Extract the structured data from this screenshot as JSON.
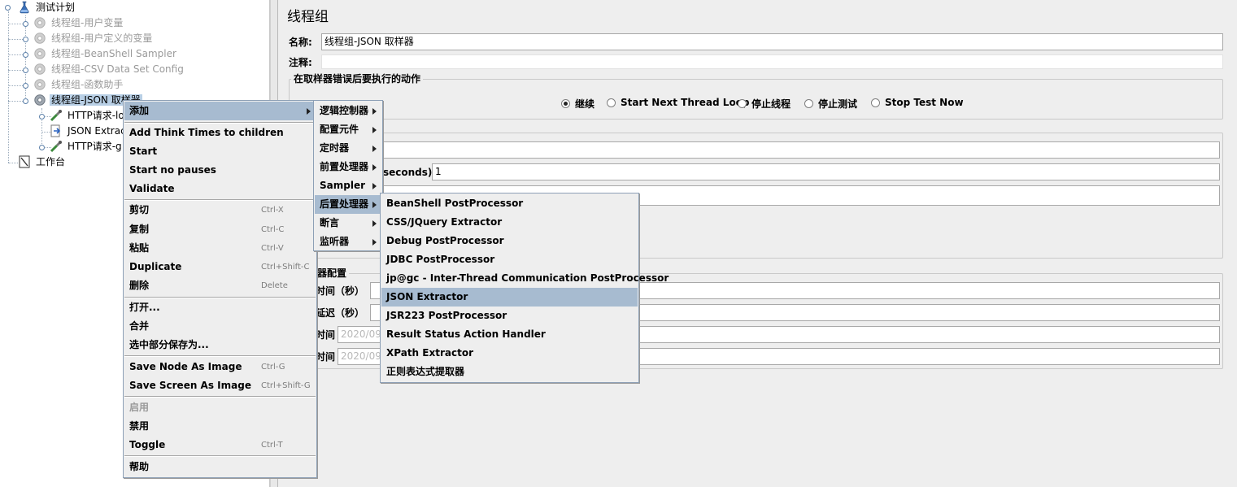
{
  "tree": {
    "root": "测试计划",
    "children": [
      {
        "label": "线程组-用户变量",
        "icon": "gear-icon",
        "disabled": true
      },
      {
        "label": "线程组-用户定义的变量",
        "icon": "gear-icon",
        "disabled": true
      },
      {
        "label": "线程组-BeanShell Sampler",
        "icon": "gear-icon",
        "disabled": true
      },
      {
        "label": "线程组-CSV Data Set Config",
        "icon": "gear-icon",
        "disabled": true
      },
      {
        "label": "线程组-函数助手",
        "icon": "gear-icon",
        "disabled": true
      },
      {
        "label": "线程组-JSON 取样器",
        "icon": "gear-icon",
        "selected": true
      }
    ],
    "sub_children": [
      {
        "label": "HTTP请求-lo",
        "icon": "pipette-icon"
      },
      {
        "label": "JSON Extrac",
        "icon": "document-arrow-icon"
      },
      {
        "label": "HTTP请求-g",
        "icon": "pipette-icon"
      }
    ],
    "workbench": "工作台"
  },
  "panel": {
    "title": "线程组",
    "name_label": "名称:",
    "name_value": "线程组-JSON 取样器",
    "comment_label": "注释:",
    "comment_value": "",
    "action_group_title": "在取样器错误后要执行的动作",
    "actions": [
      {
        "label": "继续",
        "selected": true
      },
      {
        "label": "Start Next Thread Loop",
        "selected": false
      },
      {
        "label": "停止线程",
        "selected": false
      },
      {
        "label": "停止测试",
        "selected": false
      },
      {
        "label": "Stop Test Now",
        "selected": false
      }
    ],
    "rampup_label_partial": "seconds):",
    "rampup_value": "1",
    "scheduler_title_partial": "器配置",
    "duration_label_partial": "时间（秒）",
    "delay_label_partial": "延迟（秒）",
    "start_label_partial": "时间",
    "start_value_partial": "2020/09/",
    "end_label_partial": "时间",
    "end_value_partial": "2020/09/"
  },
  "context_menu": {
    "items": [
      {
        "label": "添加",
        "submenu": true,
        "highlighted": true
      },
      {
        "sep": true
      },
      {
        "label": "Add Think Times to children"
      },
      {
        "label": "Start"
      },
      {
        "label": "Start no pauses"
      },
      {
        "label": "Validate"
      },
      {
        "sep": true
      },
      {
        "label": "剪切",
        "accel": "Ctrl-X"
      },
      {
        "label": "复制",
        "accel": "Ctrl-C"
      },
      {
        "label": "粘贴",
        "accel": "Ctrl-V"
      },
      {
        "label": "Duplicate",
        "accel": "Ctrl+Shift-C"
      },
      {
        "label": "删除",
        "accel": "Delete"
      },
      {
        "sep": true
      },
      {
        "label": "打开..."
      },
      {
        "label": "合并"
      },
      {
        "label": "选中部分保存为..."
      },
      {
        "sep": true
      },
      {
        "label": "Save Node As Image",
        "accel": "Ctrl-G"
      },
      {
        "label": "Save Screen As Image",
        "accel": "Ctrl+Shift-G"
      },
      {
        "sep": true
      },
      {
        "label": "启用",
        "disabled": true
      },
      {
        "label": "禁用"
      },
      {
        "label": "Toggle",
        "accel": "Ctrl-T"
      },
      {
        "sep": true
      },
      {
        "label": "帮助"
      }
    ]
  },
  "add_submenu": {
    "items": [
      {
        "label": "逻辑控制器"
      },
      {
        "label": "配置元件"
      },
      {
        "label": "定时器"
      },
      {
        "label": "前置处理器"
      },
      {
        "label": "Sampler"
      },
      {
        "label": "后置处理器",
        "highlighted": true
      },
      {
        "label": "断言"
      },
      {
        "label": "监听器"
      }
    ]
  },
  "postprocessor_submenu": {
    "items": [
      {
        "label": "BeanShell PostProcessor"
      },
      {
        "label": "CSS/JQuery Extractor"
      },
      {
        "label": "Debug PostProcessor"
      },
      {
        "label": "JDBC PostProcessor"
      },
      {
        "label": "jp@gc - Inter-Thread Communication PostProcessor"
      },
      {
        "label": "JSON Extractor",
        "highlighted": true
      },
      {
        "label": "JSR223 PostProcessor"
      },
      {
        "label": "Result Status Action Handler"
      },
      {
        "label": "XPath Extractor"
      },
      {
        "label": "正则表达式提取器"
      }
    ]
  }
}
